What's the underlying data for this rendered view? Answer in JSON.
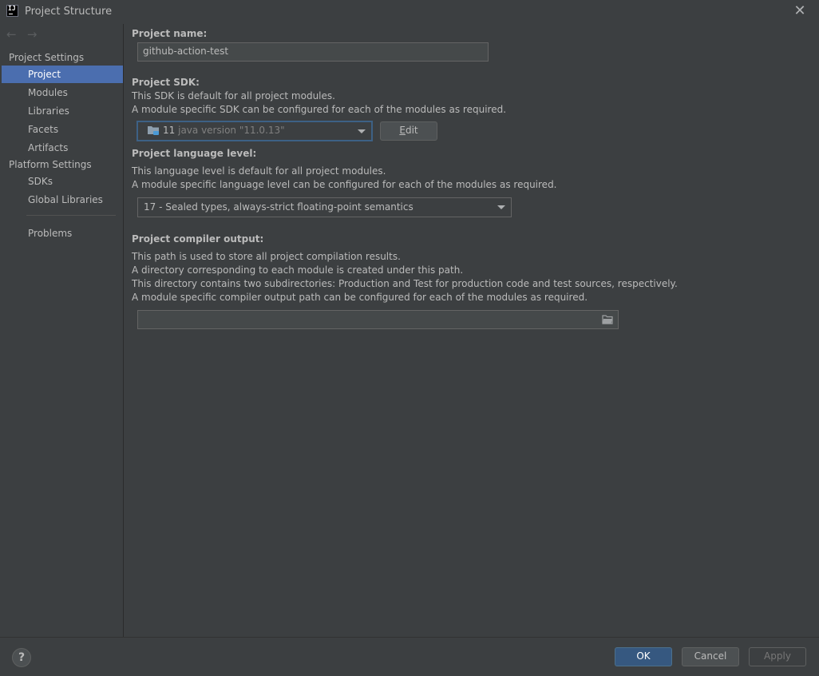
{
  "window": {
    "title": "Project Structure",
    "icon": "intellij-idea-icon",
    "close_glyph": "✕"
  },
  "nav": {
    "back": "←",
    "forward": "→"
  },
  "sidebar": {
    "project_settings_header": "Project Settings",
    "project_settings_items": [
      {
        "label": "Project",
        "selected": true
      },
      {
        "label": "Modules"
      },
      {
        "label": "Libraries"
      },
      {
        "label": "Facets"
      },
      {
        "label": "Artifacts"
      }
    ],
    "platform_settings_header": "Platform Settings",
    "platform_settings_items": [
      {
        "label": "SDKs"
      },
      {
        "label": "Global Libraries"
      }
    ],
    "problems_label": "Problems"
  },
  "project_name": {
    "label": "Project name:",
    "value": "github-action-test"
  },
  "project_sdk": {
    "label": "Project SDK:",
    "desc1": "This SDK is default for all project modules.",
    "desc2": "A module specific SDK can be configured for each of the modules as required.",
    "selected_version": "11",
    "selected_detail": "java version \"11.0.13\"",
    "edit_button": "Edit"
  },
  "language_level": {
    "label": "Project language level:",
    "desc1": "This language level is default for all project modules.",
    "desc2": "A module specific language level can be configured for each of the modules as required.",
    "selected": "17 - Sealed types, always-strict floating-point semantics"
  },
  "compiler_output": {
    "label": "Project compiler output:",
    "desc1": "This path is used to store all project compilation results.",
    "desc2": "A directory corresponding to each module is created under this path.",
    "desc3": "This directory contains two subdirectories: Production and Test for production code and test sources, respectively.",
    "desc4": "A module specific compiler output path can be configured for each of the modules as required.",
    "value": ""
  },
  "footer": {
    "help": "?",
    "ok": "OK",
    "cancel": "Cancel",
    "apply": "Apply"
  },
  "colors": {
    "background": "#3c3f41",
    "selection": "#4b6eaf",
    "primary_button": "#365880",
    "text": "#bbbbbb"
  }
}
